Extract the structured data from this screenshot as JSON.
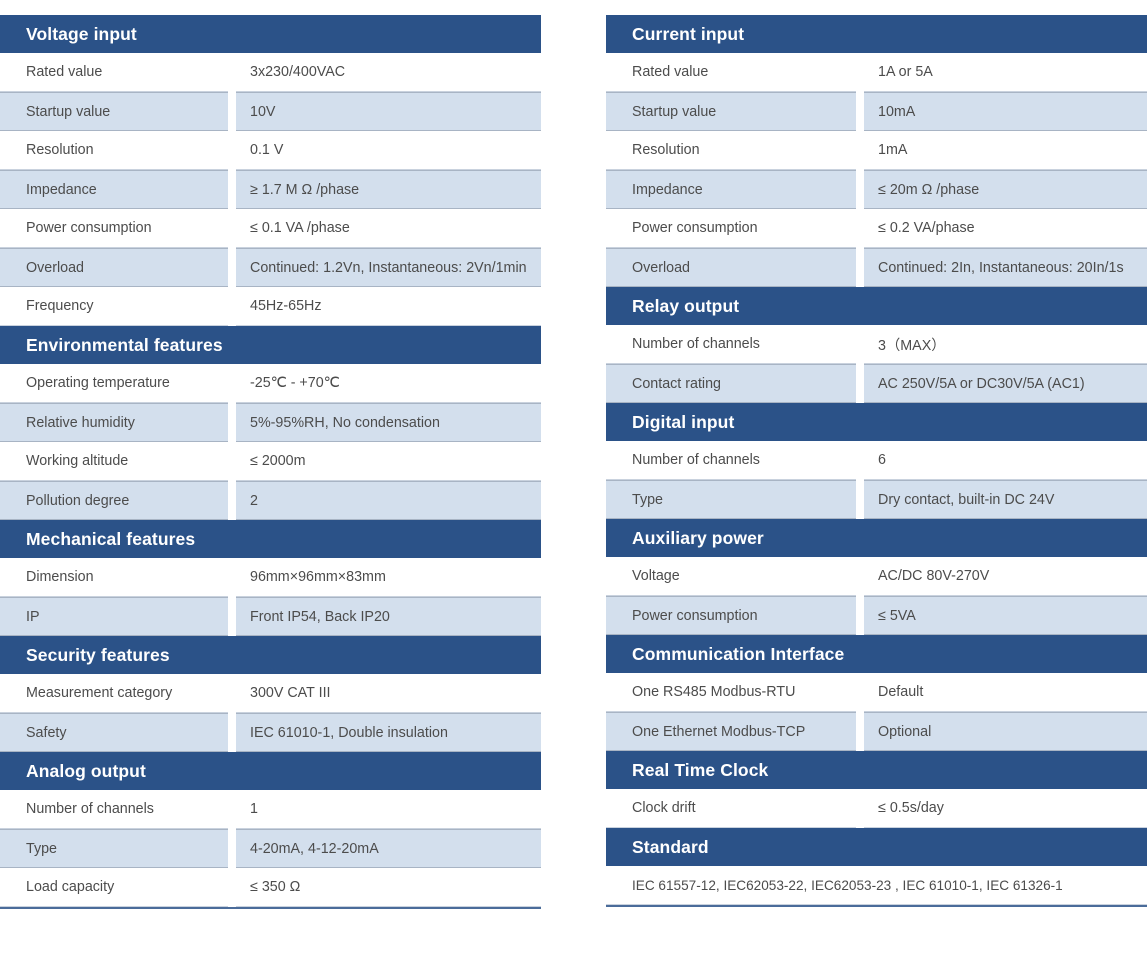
{
  "meta": {
    "doc_type": "technical-specification-table",
    "accent_color": "#2b5288",
    "stripe_color": "#d3dfed",
    "text_color": "#4c4c4c"
  },
  "left_column": {
    "sections": [
      {
        "title": "Voltage input",
        "rows": [
          {
            "label": "Rated value",
            "value": "3x230/400VAC"
          },
          {
            "label": "Startup value",
            "value": "10V"
          },
          {
            "label": "Resolution",
            "value": "0.1 V"
          },
          {
            "label": "Impedance",
            "value": "≥ 1.7 M Ω /phase"
          },
          {
            "label": "Power consumption",
            "value": "≤ 0.1 VA /phase"
          },
          {
            "label": "Overload",
            "value": "Continued: 1.2Vn, Instantaneous: 2Vn/1min"
          },
          {
            "label": "Frequency",
            "value": "45Hz-65Hz"
          }
        ]
      },
      {
        "title": "Environmental features",
        "rows": [
          {
            "label": "Operating temperature",
            "value": "-25℃ - +70℃"
          },
          {
            "label": "Relative humidity",
            "value": "5%-95%RH, No condensation"
          },
          {
            "label": "Working altitude",
            "value": "≤ 2000m"
          },
          {
            "label": "Pollution degree",
            "value": "2"
          }
        ]
      },
      {
        "title": "Mechanical features",
        "rows": [
          {
            "label": "Dimension",
            "value": "96mm×96mm×83mm"
          },
          {
            "label": "IP",
            "value": "Front IP54, Back IP20"
          }
        ]
      },
      {
        "title": "Security features",
        "rows": [
          {
            "label": "Measurement category",
            "value": "300V CAT III"
          },
          {
            "label": "Safety",
            "value": "IEC 61010-1, Double insulation"
          }
        ]
      },
      {
        "title": "Analog output",
        "rows": [
          {
            "label": "Number of channels",
            "value": "1"
          },
          {
            "label": "Type",
            "value": "4-20mA, 4-12-20mA"
          },
          {
            "label": "Load capacity",
            "value": "≤ 350 Ω"
          }
        ]
      }
    ]
  },
  "right_column": {
    "sections": [
      {
        "title": "Current input",
        "rows": [
          {
            "label": "Rated value",
            "value": "1A or 5A"
          },
          {
            "label": "Startup value",
            "value": "10mA"
          },
          {
            "label": "Resolution",
            "value": "1mA"
          },
          {
            "label": "Impedance",
            "value": "≤ 20m Ω /phase"
          },
          {
            "label": "Power consumption",
            "value": "≤ 0.2 VA/phase"
          },
          {
            "label": "Overload",
            "value": "Continued: 2In, Instantaneous: 20In/1s"
          }
        ]
      },
      {
        "title": "Relay output",
        "rows": [
          {
            "label": "Number of channels",
            "value": "3（MAX）"
          },
          {
            "label": "Contact rating",
            "value": "AC 250V/5A or DC30V/5A (AC1)"
          }
        ]
      },
      {
        "title": "Digital input",
        "rows": [
          {
            "label": "Number of channels",
            "value": "6"
          },
          {
            "label": "Type",
            "value": "Dry contact, built-in DC 24V"
          }
        ]
      },
      {
        "title": "Auxiliary power",
        "rows": [
          {
            "label": "Voltage",
            "value": "AC/DC 80V-270V"
          },
          {
            "label": "Power consumption",
            "value": "≤ 5VA"
          }
        ]
      },
      {
        "title": "Communication Interface",
        "rows": [
          {
            "label": "One RS485  Modbus-RTU",
            "value": "Default"
          },
          {
            "label": "One Ethernet Modbus-TCP",
            "value": "Optional"
          }
        ]
      },
      {
        "title": "Real Time Clock",
        "rows": [
          {
            "label": "Clock drift",
            "value": "≤ 0.5s/day"
          }
        ]
      },
      {
        "title": "Standard",
        "full_width": true,
        "rows": [
          {
            "value": "IEC 61557-12, IEC62053-22, IEC62053-23 , IEC 61010-1, IEC 61326-1"
          }
        ]
      }
    ]
  }
}
